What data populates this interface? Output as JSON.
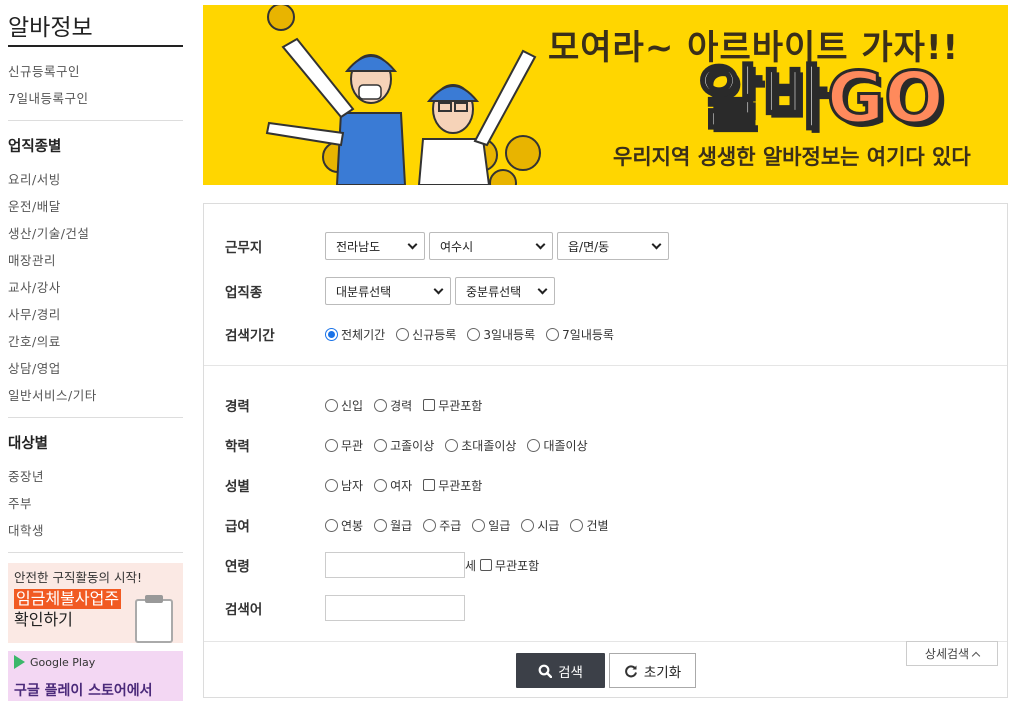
{
  "sidebar": {
    "title": "알바정보",
    "group1": [
      "신규등록구인",
      "7일내등록구인"
    ],
    "job_types": {
      "heading": "업직종별",
      "items": [
        "요리/서빙",
        "운전/배달",
        "생산/기술/건설",
        "매장관리",
        "교사/강사",
        "사무/경리",
        "간호/의료",
        "상담/영업",
        "일반서비스/기타"
      ]
    },
    "targets": {
      "heading": "대상별",
      "items": [
        "중장년",
        "주부",
        "대학생"
      ]
    },
    "banner_wage": {
      "line1": "안전한 구직활동의 시작!",
      "line2": "임금체불사업주",
      "line3": "확인하기"
    },
    "banner_gplay": {
      "badge": "Google Play",
      "line": "구글 플레이 스토어에서"
    }
  },
  "hero": {
    "headline": "모여라~ 아르바이트 가자!!",
    "logo_al": "알바",
    "logo_go": "GO",
    "tagline": "우리지역 생생한 알바정보는 여기다 있다"
  },
  "search": {
    "workplace": {
      "label": "근무지",
      "province": "전라남도",
      "city": "여수시",
      "town": "읍/면/동"
    },
    "job_type": {
      "label": "업직종",
      "major": "대분류선택",
      "minor": "중분류선택"
    },
    "period": {
      "label": "검색기간",
      "options": [
        "전체기간",
        "신규등록",
        "3일내등록",
        "7일내등록"
      ],
      "selected": "전체기간"
    },
    "career": {
      "label": "경력",
      "options": [
        "신입",
        "경력"
      ],
      "check": "무관포함"
    },
    "education": {
      "label": "학력",
      "options": [
        "무관",
        "고졸이상",
        "초대졸이상",
        "대졸이상"
      ]
    },
    "gender": {
      "label": "성별",
      "options": [
        "남자",
        "여자"
      ],
      "check": "무관포함"
    },
    "pay": {
      "label": "급여",
      "options": [
        "연봉",
        "월급",
        "주급",
        "일급",
        "시급",
        "건별"
      ]
    },
    "age": {
      "label": "연령",
      "unit": "세",
      "check": "무관포함",
      "value": ""
    },
    "keyword": {
      "label": "검색어",
      "value": ""
    },
    "buttons": {
      "search": "검색",
      "reset": "초기화",
      "detail": "상세검색"
    }
  },
  "colors": {
    "hero_bg": "#ffd600",
    "search_btn": "#3c4048",
    "radio_selected": "#1a73e8",
    "wage_highlight": "#f15a22"
  }
}
